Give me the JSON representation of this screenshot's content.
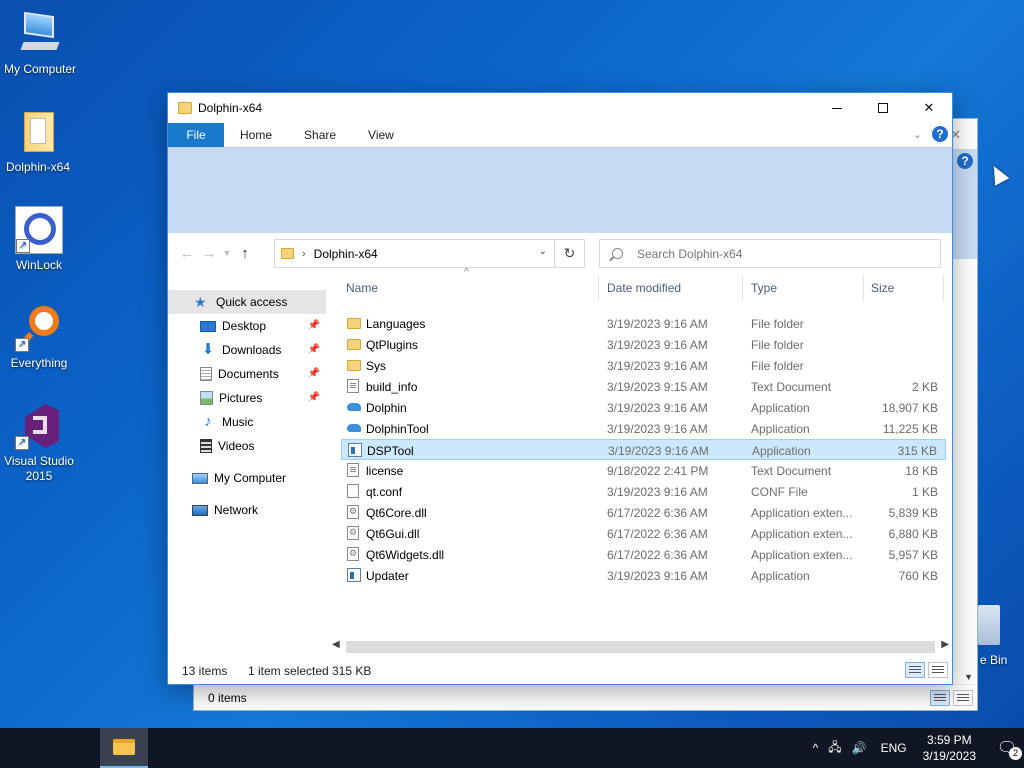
{
  "desktop": {
    "icons": [
      {
        "label": "My Computer",
        "icon": "computer-icon"
      },
      {
        "label": "Dolphin-x64",
        "icon": "folder-icon"
      },
      {
        "label": "WinLock",
        "icon": "winlock-icon"
      },
      {
        "label": "Everything",
        "icon": "everything-icon"
      },
      {
        "label": "Visual Studio 2015",
        "icon": "visual-studio-icon"
      }
    ],
    "recycle_bin_label": "e Bin"
  },
  "back_window": {
    "status_text": "0 items"
  },
  "window": {
    "title": "Dolphin-x64",
    "tabs": [
      "File",
      "Home",
      "Share",
      "View"
    ],
    "help_label": "?",
    "address": {
      "path": "Dolphin-x64"
    },
    "search_placeholder": "Search Dolphin-x64",
    "nav": [
      {
        "label": "Quick access",
        "icon": "star-icon",
        "selected": true
      },
      {
        "label": "Desktop",
        "icon": "desktop-icon",
        "pinned": true
      },
      {
        "label": "Downloads",
        "icon": "downloads-icon",
        "pinned": true
      },
      {
        "label": "Documents",
        "icon": "documents-icon",
        "pinned": true
      },
      {
        "label": "Pictures",
        "icon": "pictures-icon",
        "pinned": true
      },
      {
        "label": "Music",
        "icon": "music-icon"
      },
      {
        "label": "Videos",
        "icon": "videos-icon"
      },
      {
        "label": "My Computer",
        "icon": "computer-icon"
      },
      {
        "label": "Network",
        "icon": "network-icon"
      }
    ],
    "columns": [
      "Name",
      "Date modified",
      "Type",
      "Size"
    ],
    "files": [
      {
        "name": "Languages",
        "date": "3/19/2023 9:16 AM",
        "type": "File folder",
        "size": "",
        "icon": "folder"
      },
      {
        "name": "QtPlugins",
        "date": "3/19/2023 9:16 AM",
        "type": "File folder",
        "size": "",
        "icon": "folder"
      },
      {
        "name": "Sys",
        "date": "3/19/2023 9:16 AM",
        "type": "File folder",
        "size": "",
        "icon": "folder"
      },
      {
        "name": "build_info",
        "date": "3/19/2023 9:15 AM",
        "type": "Text Document",
        "size": "2 KB",
        "icon": "doc"
      },
      {
        "name": "Dolphin",
        "date": "3/19/2023 9:16 AM",
        "type": "Application",
        "size": "18,907 KB",
        "icon": "dolphin"
      },
      {
        "name": "DolphinTool",
        "date": "3/19/2023 9:16 AM",
        "type": "Application",
        "size": "11,225 KB",
        "icon": "dolphin"
      },
      {
        "name": "DSPTool",
        "date": "3/19/2023 9:16 AM",
        "type": "Application",
        "size": "315 KB",
        "icon": "app",
        "selected": true
      },
      {
        "name": "license",
        "date": "9/18/2022 2:41 PM",
        "type": "Text Document",
        "size": "18 KB",
        "icon": "doc"
      },
      {
        "name": "qt.conf",
        "date": "3/19/2023 9:16 AM",
        "type": "CONF File",
        "size": "1 KB",
        "icon": "conf"
      },
      {
        "name": "Qt6Core.dll",
        "date": "6/17/2022 6:36 AM",
        "type": "Application exten...",
        "size": "5,839 KB",
        "icon": "dll"
      },
      {
        "name": "Qt6Gui.dll",
        "date": "6/17/2022 6:36 AM",
        "type": "Application exten...",
        "size": "6,880 KB",
        "icon": "dll"
      },
      {
        "name": "Qt6Widgets.dll",
        "date": "6/17/2022 6:36 AM",
        "type": "Application exten...",
        "size": "5,957 KB",
        "icon": "dll"
      },
      {
        "name": "Updater",
        "date": "3/19/2023 9:16 AM",
        "type": "Application",
        "size": "760 KB",
        "icon": "app"
      }
    ],
    "status": {
      "items": "13 items",
      "selected": "1 item selected",
      "selected_size": "315 KB"
    }
  },
  "taskbar": {
    "language": "ENG",
    "time": "3:59 PM",
    "date": "3/19/2023",
    "notification_count": "2"
  }
}
